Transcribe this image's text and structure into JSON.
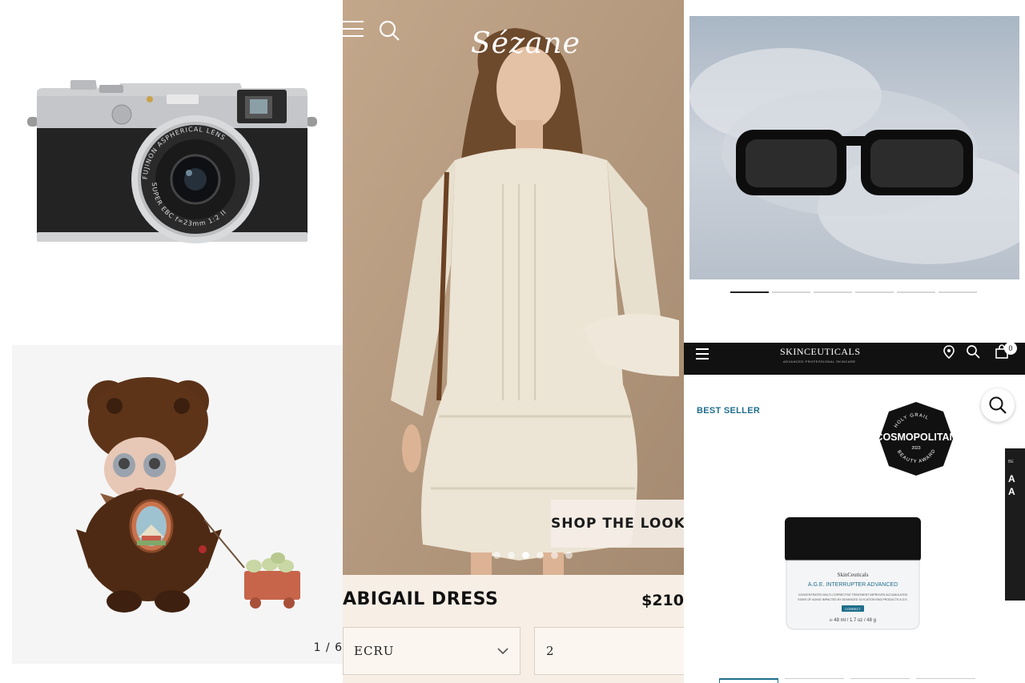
{
  "camera_panel": {
    "lens_text_top": "FUJINON ASPHERICAL LENS",
    "lens_text_bottom": "SUPER EBC f=23mm 1:2 II"
  },
  "toy_panel": {
    "counter": "1 / 6"
  },
  "sezane_panel": {
    "logo": "Sézane",
    "shop_the_look": "SHOP THE LOOK",
    "product_name": "ABIGAIL DRESS",
    "product_price": "$210",
    "color_select": "ECRU",
    "size_select": "2",
    "carousel_dots": 6,
    "active_dot": 3
  },
  "glasses_panel": {
    "carousel_bars": 6,
    "active_bar": 1
  },
  "skinceuticals_panel": {
    "brand": "SKINCEUTICALS",
    "brand_sub": "ADVANCED PROFESSIONAL SKINCARE",
    "bag_count": "0",
    "best_seller": "BEST SELLER",
    "badge_main": "COSMOPOLITAN",
    "badge_top": "HOLY GRAIL",
    "badge_bottom": "BEAUTY AWARD",
    "badge_year": "2023",
    "jar_brand": "SkinCeuticals",
    "jar_product": "A.G.E. INTERRUPTER ADVANCED",
    "jar_desc_1": "CONCENTRATED MULTI-CORRECTIVE TREATMENT IMPROVES ACCUMULATED",
    "jar_desc_2": "SIGNS OF AGING IMPACTED BY ADVANCED GLYCATION END-PRODUCTS A.G.E.",
    "jar_tag": "CORRECT",
    "jar_volume": "℮ 48 ml / 1.7 oz / 48 g",
    "side_card_small": "BE",
    "side_card_big": "A\nA"
  },
  "colors": {
    "skin_accent": "#1f6e8c",
    "sezane_bg": "#f7efe6",
    "nav_black": "#111111"
  }
}
